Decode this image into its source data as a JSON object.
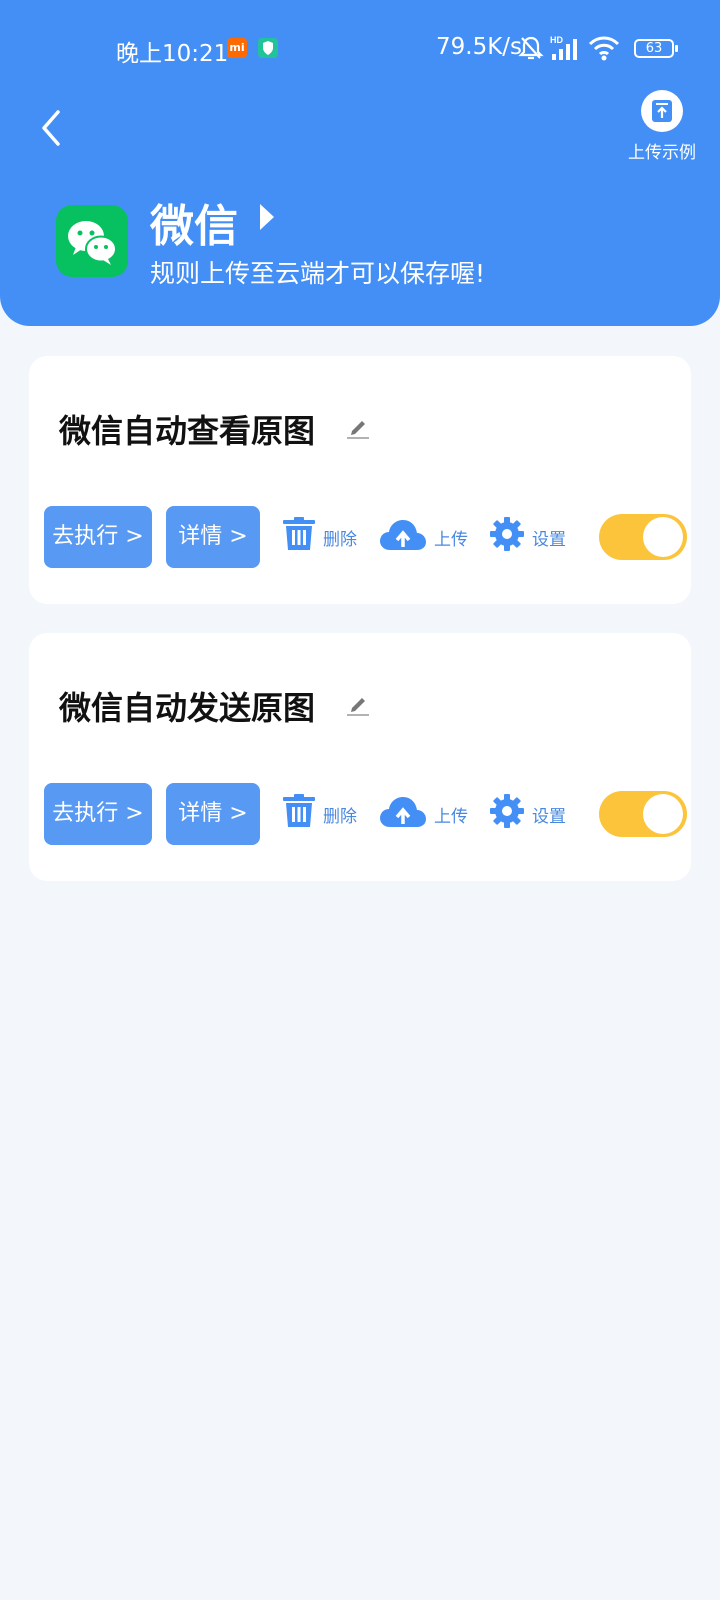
{
  "status_bar": {
    "time": "晚上10:21",
    "mi_badge": "mi",
    "net_speed": "79.5K/s",
    "battery": "63"
  },
  "header": {
    "upload_example_label": "上传示例",
    "app_title": "微信",
    "app_subtitle": "规则上传至云端才可以保存喔!"
  },
  "rules": [
    {
      "title": "微信自动查看原图",
      "run_label": "去执行 >",
      "detail_label": "详情 >",
      "delete_label": "删除",
      "upload_label": "上传",
      "settings_label": "设置",
      "enabled": true
    },
    {
      "title": "微信自动发送原图",
      "run_label": "去执行 >",
      "detail_label": "详情 >",
      "delete_label": "删除",
      "upload_label": "上传",
      "settings_label": "设置",
      "enabled": true
    }
  ],
  "colors": {
    "header_bg": "#448ff5",
    "button_bg": "#5899f3",
    "toggle_on": "#fbc43b",
    "wechat_green": "#07c160"
  }
}
